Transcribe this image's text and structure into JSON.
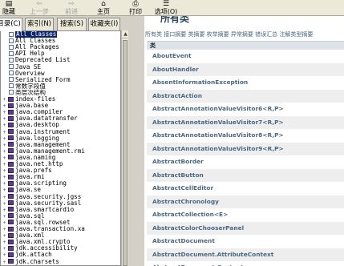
{
  "toolbar": {
    "buttons": [
      {
        "label": "隐藏",
        "icon": "hide-icon",
        "enabled": true
      },
      {
        "label": "上一步",
        "icon": "back-icon",
        "enabled": false
      },
      {
        "label": "前进",
        "icon": "forward-icon",
        "enabled": false
      },
      {
        "label": "主页",
        "icon": "home-icon",
        "enabled": true
      },
      {
        "label": "打印",
        "icon": "print-icon",
        "enabled": true
      },
      {
        "label": "选项(O)",
        "icon": "options-icon",
        "enabled": true
      }
    ]
  },
  "tabs": [
    "目录(C)",
    "索引(N)",
    "搜索(S)",
    "收藏夹(I)"
  ],
  "active_tab": 0,
  "tree": {
    "items": [
      {
        "label": "All Classes",
        "icon": "page-icon",
        "expander": "",
        "selected": true
      },
      {
        "label": "All Classes",
        "icon": "page-icon",
        "expander": "",
        "selected": false
      },
      {
        "label": "All Packages",
        "icon": "page-icon",
        "expander": "",
        "selected": false
      },
      {
        "label": "API Help",
        "icon": "page-icon",
        "expander": "",
        "selected": false
      },
      {
        "label": "Deprecated List",
        "icon": "page-icon",
        "expander": "",
        "selected": false
      },
      {
        "label": "Java SE",
        "icon": "page-icon",
        "expander": "",
        "selected": false
      },
      {
        "label": "Overview",
        "icon": "page-icon",
        "expander": "",
        "selected": false
      },
      {
        "label": "Serialized Form",
        "icon": "page-icon",
        "expander": "",
        "selected": false
      },
      {
        "label": "常数字段值",
        "icon": "page-icon",
        "expander": "",
        "selected": false
      },
      {
        "label": "类层次结构",
        "icon": "page-icon",
        "expander": "",
        "selected": false
      },
      {
        "label": "index-files",
        "icon": "book-icon",
        "expander": "+",
        "selected": false
      },
      {
        "label": "java.base",
        "icon": "book-icon",
        "expander": "+",
        "selected": false
      },
      {
        "label": "java.compiler",
        "icon": "book-icon",
        "expander": "+",
        "selected": false
      },
      {
        "label": "java.datatransfer",
        "icon": "book-icon",
        "expander": "+",
        "selected": false
      },
      {
        "label": "java.desktop",
        "icon": "book-icon",
        "expander": "+",
        "selected": false
      },
      {
        "label": "java.instrument",
        "icon": "book-icon",
        "expander": "+",
        "selected": false
      },
      {
        "label": "java.logging",
        "icon": "book-icon",
        "expander": "+",
        "selected": false
      },
      {
        "label": "java.management",
        "icon": "book-icon",
        "expander": "+",
        "selected": false
      },
      {
        "label": "java.management.rmi",
        "icon": "book-icon",
        "expander": "+",
        "selected": false
      },
      {
        "label": "java.naming",
        "icon": "book-icon",
        "expander": "+",
        "selected": false
      },
      {
        "label": "java.net.http",
        "icon": "book-icon",
        "expander": "+",
        "selected": false
      },
      {
        "label": "java.prefs",
        "icon": "book-icon",
        "expander": "+",
        "selected": false
      },
      {
        "label": "java.rmi",
        "icon": "book-icon",
        "expander": "+",
        "selected": false
      },
      {
        "label": "java.scripting",
        "icon": "book-icon",
        "expander": "+",
        "selected": false
      },
      {
        "label": "java.se",
        "icon": "book-icon",
        "expander": "+",
        "selected": false
      },
      {
        "label": "java.security.jgss",
        "icon": "book-icon",
        "expander": "+",
        "selected": false
      },
      {
        "label": "java.security.sasl",
        "icon": "book-icon",
        "expander": "+",
        "selected": false
      },
      {
        "label": "java.smartcardio",
        "icon": "book-icon",
        "expander": "+",
        "selected": false
      },
      {
        "label": "java.sql",
        "icon": "book-icon",
        "expander": "+",
        "selected": false
      },
      {
        "label": "java.sql.rowset",
        "icon": "book-icon",
        "expander": "+",
        "selected": false
      },
      {
        "label": "java.transaction.xa",
        "icon": "book-icon",
        "expander": "+",
        "selected": false
      },
      {
        "label": "java.xml",
        "icon": "book-icon",
        "expander": "+",
        "selected": false
      },
      {
        "label": "java.xml.crypto",
        "icon": "book-icon",
        "expander": "+",
        "selected": false
      },
      {
        "label": "jdk.accessibility",
        "icon": "book-icon",
        "expander": "+",
        "selected": false
      },
      {
        "label": "jdk.attach",
        "icon": "book-icon",
        "expander": "+",
        "selected": false
      },
      {
        "label": "jdk.charsets",
        "icon": "book-icon",
        "expander": "+",
        "selected": false
      }
    ]
  },
  "content": {
    "heading": "所有类",
    "nav_links": "所有类 接口摘要 类摘要 枚举摘要 异常摘要 错误汇总 注解类型摘要",
    "table_header": "类",
    "classes": [
      "AboutEvent",
      "AboutHandler",
      "AbsentInformationException",
      "AbstractAction",
      "AbstractAnnotationValueVisitor6<R,P>",
      "AbstractAnnotationValueVisitor7<R,P>",
      "AbstractAnnotationValueVisitor8<R,P>",
      "AbstractAnnotationValueVisitor9<R,P>",
      "AbstractBorder",
      "AbstractButton",
      "AbstractCellEditor",
      "AbstractChronology",
      "AbstractCollection<E>",
      "AbstractColorChooserPanel",
      "AbstractDocument",
      "AbstractDocument.AttributeContext",
      "AbstractDocument.Content"
    ]
  },
  "colors": {
    "selection": "#0a246a",
    "link": "#4a6782",
    "table_header_bg": "#dee3e9",
    "alt_row_bg": "#eeeeef"
  }
}
